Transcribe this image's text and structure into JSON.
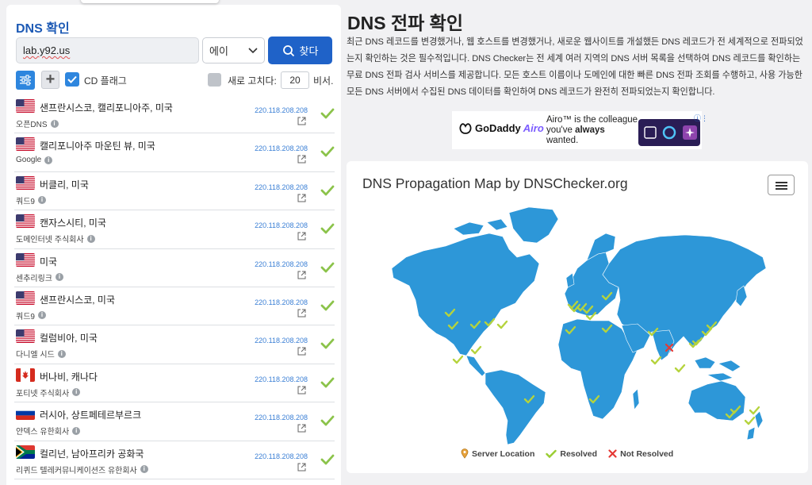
{
  "left": {
    "title": "DNS 확인",
    "domain_value": "lab.y92.us",
    "record_type": "에이",
    "search_label": "찾다",
    "cd_flag_label": "CD 플래그",
    "refresh_label": "새로 고치다:",
    "refresh_value": "20",
    "refresh_unit": "비서."
  },
  "servers": [
    {
      "flag": "us",
      "location": "샌프란시스코, 캘리포니아주, 미국",
      "provider": "오픈DNS",
      "ip": "220.118.208.208"
    },
    {
      "flag": "us",
      "location": "캘리포니아주 마운틴 뷰, 미국",
      "provider": "Google",
      "ip": "220.118.208.208"
    },
    {
      "flag": "us",
      "location": "버클리, 미국",
      "provider": "쿼드9",
      "ip": "220.118.208.208"
    },
    {
      "flag": "us",
      "location": "캔자스시티, 미국",
      "provider": "도메인터넷 주식회사",
      "ip": "220.118.208.208"
    },
    {
      "flag": "us",
      "location": "미국",
      "provider": "센추리링크",
      "ip": "220.118.208.208"
    },
    {
      "flag": "us",
      "location": "샌프란시스코, 미국",
      "provider": "쿼드9",
      "ip": "220.118.208.208"
    },
    {
      "flag": "us",
      "location": "컬럼비아, 미국",
      "provider": "다니엘 시드",
      "ip": "220.118.208.208"
    },
    {
      "flag": "ca",
      "location": "버나비, 캐나다",
      "provider": "포티넷 주식회사",
      "ip": "220.118.208.208"
    },
    {
      "flag": "ru",
      "location": "러시아, 상트페테르부르크",
      "provider": "얀덱스 유한회사",
      "ip": "220.118.208.208"
    },
    {
      "flag": "za",
      "location": "컬리넌, 남아프리카 공화국",
      "provider": "리퀴드 텔레커뮤니케이션즈 유한회사",
      "ip": "220.118.208.208"
    }
  ],
  "main": {
    "title": "DNS 전파 확인",
    "description": "최근 DNS 레코드를 변경했거나, 웹 호스트를 변경했거나, 새로운 웹사이트를 개설했든 DNS 레코드가 전 세계적으로 전파되었는지 확인하는 것은 필수적입니다. DNS Checker는 전 세계 여러 지역의 DNS 서버 목록을 선택하여 DNS 레코드를 확인하는 무료 DNS 전파 검사 서비스를 제공합니다. 모든 호스트 이름이나 도메인에 대한 빠른 DNS 전파 조회를 수행하고, 사용 가능한 모든 DNS 서버에서 수집된 DNS 데이터를 확인하여 DNS 레코드가 완전히 전파되었는지 확인합니다."
  },
  "ad": {
    "brand": "GoDaddy",
    "brand_product": "Airo",
    "tagline_1": "Airo™ is the colleague",
    "tagline_2": "you've",
    "tagline_bold": "always",
    "tagline_3": "wanted."
  },
  "map": {
    "title": "DNS Propagation Map by DNSChecker.org",
    "legend_server": "Server Location",
    "legend_resolved": "Resolved",
    "legend_not_resolved": "Not Resolved",
    "land_color": "#2d97d8",
    "resolved_color": "#9acd32",
    "not_resolved_color": "#e53935"
  }
}
